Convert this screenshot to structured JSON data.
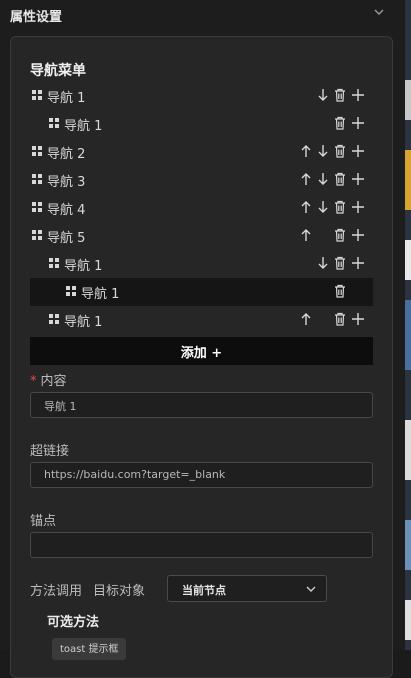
{
  "panel": {
    "title": "属性设置"
  },
  "nav_menu": {
    "title": "导航菜单",
    "items": [
      {
        "label": "导航 1",
        "actions": [
          "down",
          "delete",
          "add"
        ]
      },
      {
        "label": "导航 1",
        "actions": [
          "delete",
          "add"
        ]
      },
      {
        "label": "导航 2",
        "actions": [
          "up",
          "down",
          "delete",
          "add"
        ]
      },
      {
        "label": "导航 3",
        "actions": [
          "up",
          "down",
          "delete",
          "add"
        ]
      },
      {
        "label": "导航 4",
        "actions": [
          "up",
          "down",
          "delete",
          "add"
        ]
      },
      {
        "label": "导航 5",
        "actions": [
          "up",
          "delete",
          "add"
        ]
      },
      {
        "label": "导航 1",
        "actions": [
          "down",
          "delete",
          "add"
        ]
      },
      {
        "label": "导航 1",
        "actions": [
          "delete"
        ],
        "selected": true
      },
      {
        "label": "导航 1",
        "actions": [
          "up",
          "delete",
          "add"
        ]
      }
    ],
    "add_button": "添加 +"
  },
  "form": {
    "content": {
      "required_mark": "*",
      "label": "内容",
      "value": "导航 1"
    },
    "link": {
      "label": "超链接",
      "value": "https://baidu.com?target=_blank"
    },
    "anchor": {
      "label": "锚点",
      "value": ""
    },
    "method": {
      "label": "方法调用",
      "target_label": "目标对象",
      "target_value": "当前节点",
      "options_title": "可选方法",
      "option_chip": "toast 提示框"
    }
  },
  "icons": {
    "collapse": "chevron-down-icon",
    "drag": "drag-handle-icon",
    "up": "arrow-up-icon",
    "down": "arrow-down-icon",
    "delete": "trash-icon",
    "add": "plus-icon"
  },
  "colors": {
    "background": "#1b1b1b",
    "card": "#262626",
    "selected_row": "#151515",
    "add_button": "#0d0d0d",
    "required": "#e05050"
  }
}
